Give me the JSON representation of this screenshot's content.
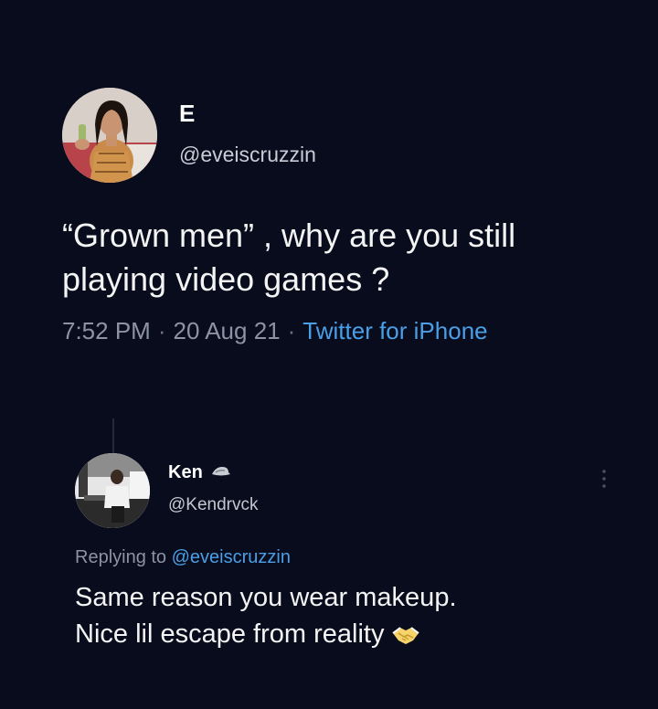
{
  "tweet": {
    "display_name": "E",
    "handle": "@eveiscruzzin",
    "text_line1": "“Grown men” , why are you still",
    "text_line2": "playing video games ?",
    "time": "7:52 PM",
    "date": "20 Aug 21",
    "source": "Twitter for iPhone",
    "separator": "·"
  },
  "reply": {
    "display_name": "Ken",
    "name_emoji_icon": "hat-icon",
    "handle": "@Kendrvck",
    "replying_prefix": "Replying to",
    "replying_to": "@eveiscruzzin",
    "text_line1": "Same reason you wear makeup.",
    "text_line2": "Nice lil escape from reality",
    "emoji_icon": "handshake-icon"
  },
  "colors": {
    "background": "#080c1d",
    "link": "#4a9fe6",
    "muted": "#8c93a3"
  }
}
